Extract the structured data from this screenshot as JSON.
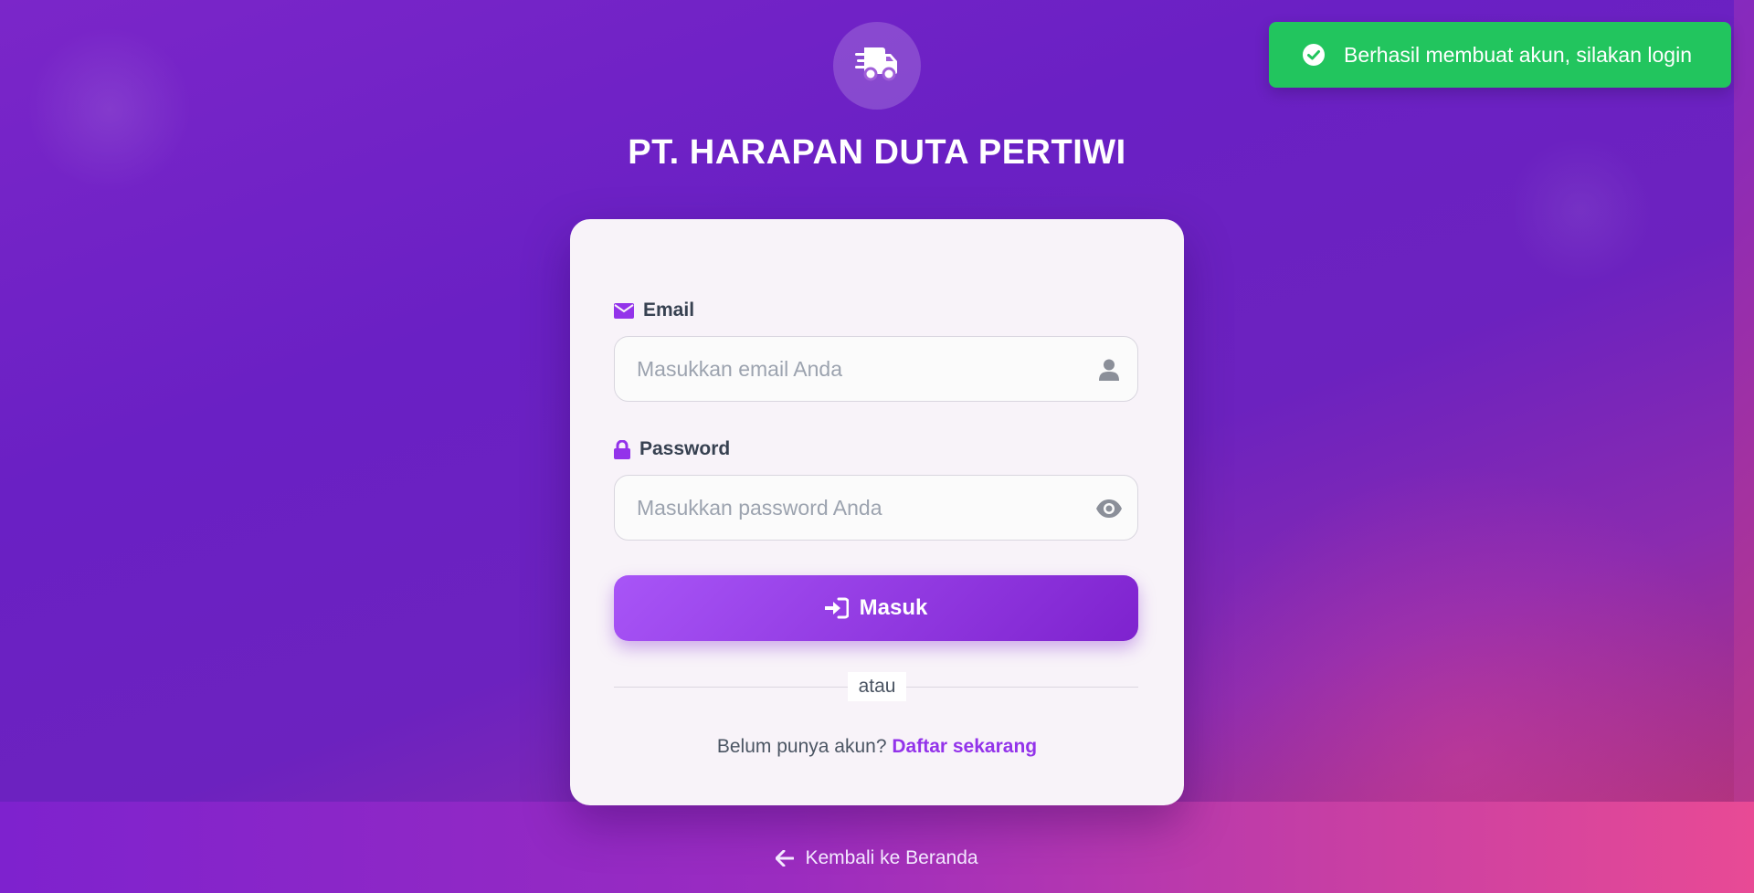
{
  "brand": {
    "name": "PT. HARAPAN DUTA PERTIWI",
    "logo_icon": "truck-fast-icon"
  },
  "login_form": {
    "email": {
      "label": "Email",
      "label_icon": "envelope-icon",
      "placeholder": "Masukkan email Anda",
      "value": "",
      "trailing_icon": "user-icon"
    },
    "password": {
      "label": "Password",
      "label_icon": "lock-icon",
      "placeholder": "Masukkan password Anda",
      "value": "",
      "trailing_icon": "eye-icon"
    },
    "submit": {
      "label": "Masuk",
      "icon": "sign-in-icon"
    },
    "divider_text": "atau",
    "register": {
      "prompt": "Belum punya akun?",
      "link_label": "Daftar sekarang"
    }
  },
  "footer": {
    "back_link_label": "Kembali ke Beranda",
    "back_icon": "arrow-left-icon"
  },
  "toast": {
    "message": "Berhasil membuat akun, silakan login",
    "icon": "check-circle-icon",
    "type": "success"
  },
  "colors": {
    "accent": "#9333ea",
    "button_gradient_start": "#a855f7",
    "button_gradient_end": "#7e22ce",
    "toast_success": "#22c55e",
    "background_start": "#7e22ce",
    "background_end": "#e84a95"
  }
}
